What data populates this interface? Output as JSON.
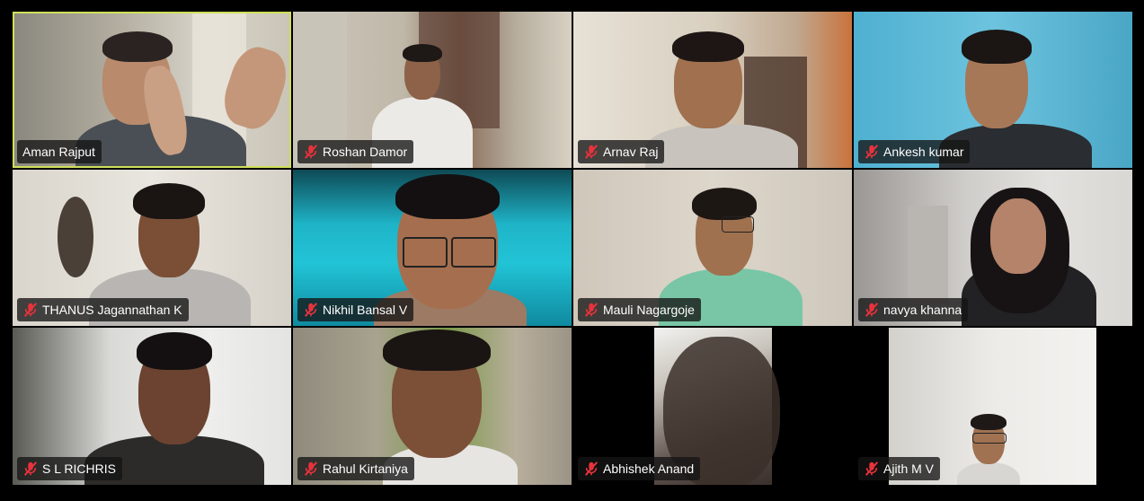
{
  "participants": [
    {
      "name": "Aman Rajput",
      "muted": false,
      "active_speaker": true
    },
    {
      "name": "Roshan Damor",
      "muted": true
    },
    {
      "name": "Arnav Raj",
      "muted": true
    },
    {
      "name": "Ankesh kumar",
      "muted": true
    },
    {
      "name": "THANUS Jagannathan K",
      "muted": true
    },
    {
      "name": "Nikhil Bansal V",
      "muted": true
    },
    {
      "name": "Mauli Nagargoje",
      "muted": true
    },
    {
      "name": "navya khanna",
      "muted": true
    },
    {
      "name": "S L RICHRIS",
      "muted": true
    },
    {
      "name": "Rahul Kirtaniya",
      "muted": true
    },
    {
      "name": "Abhishek Anand",
      "muted": true
    },
    {
      "name": "Ajith M V",
      "muted": true
    }
  ],
  "colors": {
    "active_speaker_border": "#cfe05a",
    "mute_icon": "#e8323c",
    "name_tag_bg": "#141414"
  },
  "icons": {
    "mute": "microphone-muted-icon"
  }
}
